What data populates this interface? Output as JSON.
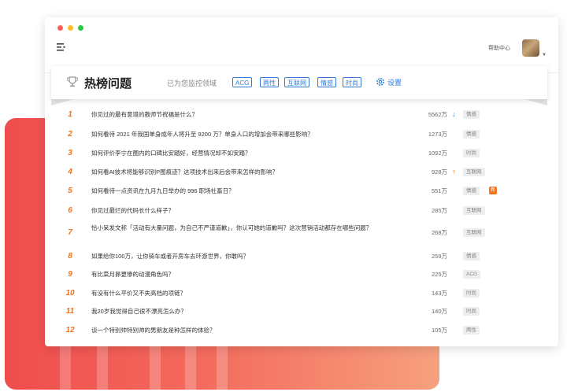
{
  "header": {
    "help_label": "帮助中心",
    "title": "热榜问题",
    "monitor_label": "已为您监控领域",
    "tags": [
      "ACG",
      "两性",
      "互联网",
      "情感",
      "时尚"
    ],
    "settings_label": "设置"
  },
  "colors": {
    "accent_blue": "#2f7bd9",
    "rank_orange": "#f0731d",
    "background_gradient_start": "#ef4d4d",
    "background_gradient_end": "#f7a07f"
  },
  "icons": {
    "menu": "menu-icon",
    "trophy": "trophy-icon",
    "settings": "gear-icon",
    "trend_down": "arrow-down-icon",
    "trend_up": "arrow-up-icon"
  },
  "rows": [
    {
      "rank": "1",
      "question": "你见过的最有意境的教师节祝福是什么？",
      "heat": "5562万",
      "trend": "↓",
      "category": "情感"
    },
    {
      "rank": "2",
      "question": "如何看待 2021 年我国单身成年人将升至 9200 万？单身人口的增加会带来哪些影响？",
      "heat": "1273万",
      "category": "情感"
    },
    {
      "rank": "3",
      "question": "如何评价李宁在圈内的口碑比安踏好，经营情况却不如安踏？",
      "heat": "1092万",
      "category": "时尚"
    },
    {
      "rank": "4",
      "question": "如何看AI技术将能够识别P图痕迹？这项技术出来后会带来怎样的影响？",
      "heat": "928万",
      "trend": "↑",
      "category": "互联网"
    },
    {
      "rank": "5",
      "question": "如何看待一点资讯在九月九日举办的 996 职场社畜日？",
      "heat": "551万",
      "category": "情感",
      "badge": "新"
    },
    {
      "rank": "6",
      "question": "你见过最烂的代码长什么样子？",
      "heat": "285万",
      "category": "互联网"
    },
    {
      "rank": "7",
      "question": "恰小呆发文称「活动有大量问题，为自己不严谨道歉」，你认可她的道歉吗？这次营销活动都存在哪些问题？",
      "heat": "268万",
      "category": "互联网"
    },
    {
      "rank": "8",
      "question": "如果给你100万，让你骑车或者开房车去环游世界，你敢吗？",
      "heat": "259万",
      "category": "情感"
    },
    {
      "rank": "9",
      "question": "有比菜月昴更惨的动漫角色吗？",
      "heat": "225万",
      "category": "ACG"
    },
    {
      "rank": "10",
      "question": "有没有什么平价又不失高档的项链？",
      "heat": "143万",
      "category": "时尚"
    },
    {
      "rank": "11",
      "question": "我20岁我觉得自己很不漂亮怎么办？",
      "heat": "140万",
      "category": "时尚"
    },
    {
      "rank": "12",
      "question": "谈一个特别帅特别帅的男朋友是种怎样的体验？",
      "heat": "105万",
      "category": "两性"
    }
  ]
}
